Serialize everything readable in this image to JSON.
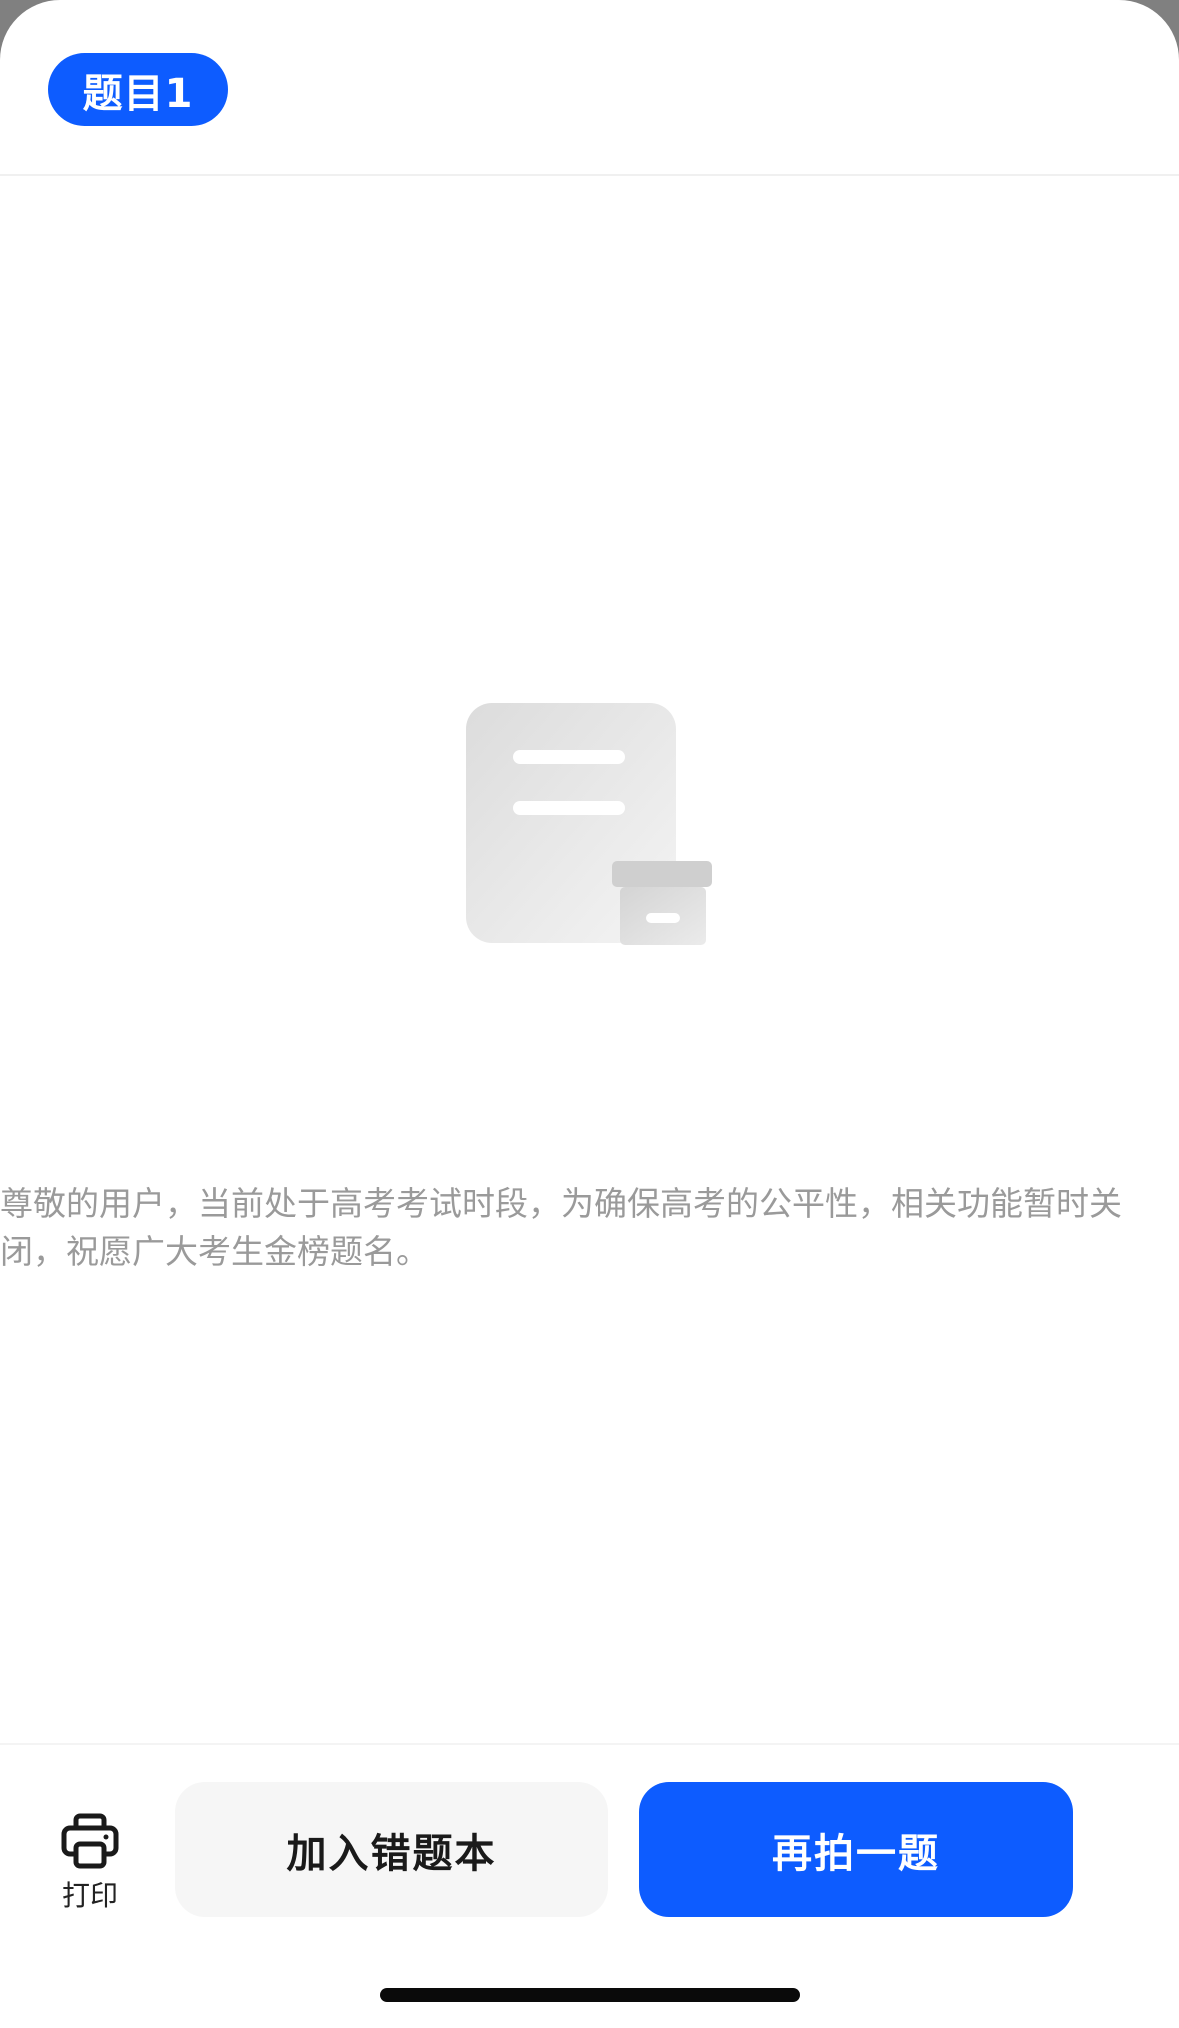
{
  "header": {
    "tab_label": "题目1"
  },
  "empty_state": {
    "icon": "document-archive-icon",
    "message": "尊敬的用户，当前处于高考考试时段，为确保高考的公平性，相关功能暂时关闭，祝愿广大考生金榜题名。"
  },
  "toolbar": {
    "print_icon": "printer-icon",
    "print_label": "打印",
    "add_wrong_label": "加入错题本",
    "retake_label": "再拍一题"
  },
  "colors": {
    "accent": "#0d5cff",
    "secondary_button_bg": "#f6f6f6",
    "notice_text": "#9a9a9a"
  }
}
